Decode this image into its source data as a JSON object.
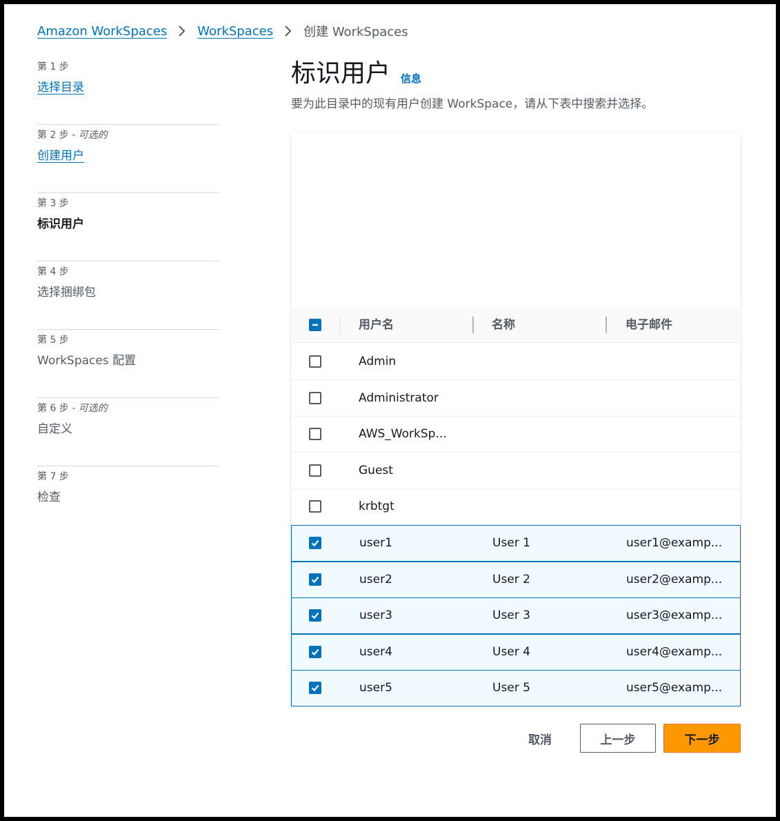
{
  "breadcrumb": {
    "items": [
      "Amazon WorkSpaces",
      "WorkSpaces"
    ],
    "current": "创建 WorkSpaces"
  },
  "steps": [
    {
      "label": "第 1 步",
      "optional": "",
      "title": "选择目录",
      "state": "done"
    },
    {
      "label": "第 2 步",
      "optional": " - 可选的",
      "title": "创建用户",
      "state": "done"
    },
    {
      "label": "第 3 步",
      "optional": "",
      "title": "标识用户",
      "state": "active"
    },
    {
      "label": "第 4 步",
      "optional": "",
      "title": "选择捆绑包",
      "state": "pending"
    },
    {
      "label": "第 5 步",
      "optional": "",
      "title": "WorkSpaces 配置",
      "state": "pending"
    },
    {
      "label": "第 6 步",
      "optional": " - 可选的",
      "title": "自定义",
      "state": "pending"
    },
    {
      "label": "第 7 步",
      "optional": "",
      "title": "检查",
      "state": "pending"
    }
  ],
  "main": {
    "title": "标识用户",
    "info": "信息",
    "description": "要为此目录中的现有用户创建 WorkSpace，请从下表中搜索并选择。"
  },
  "table": {
    "columns": [
      "用户名",
      "名称",
      "电子邮件"
    ],
    "select_all_state": "indeterminate",
    "rows": [
      {
        "username": "Admin",
        "name": "",
        "email": "",
        "selected": false
      },
      {
        "username": "Administrator",
        "name": "",
        "email": "",
        "selected": false
      },
      {
        "username": "AWS_WorkSp...",
        "name": "",
        "email": "",
        "selected": false
      },
      {
        "username": "Guest",
        "name": "",
        "email": "",
        "selected": false
      },
      {
        "username": "krbtgt",
        "name": "",
        "email": "",
        "selected": false
      },
      {
        "username": "user1",
        "name": "User 1",
        "email": "user1@examp...",
        "selected": true
      },
      {
        "username": "user2",
        "name": "User 2",
        "email": "user2@examp...",
        "selected": true
      },
      {
        "username": "user3",
        "name": "User 3",
        "email": "user3@examp...",
        "selected": true
      },
      {
        "username": "user4",
        "name": "User 4",
        "email": "user4@examp...",
        "selected": true
      },
      {
        "username": "user5",
        "name": "User 5",
        "email": "user5@examp...",
        "selected": true
      }
    ]
  },
  "buttons": {
    "cancel": "取消",
    "previous": "上一步",
    "next": "下一步"
  },
  "colors": {
    "link": "#0073bb",
    "primary_button": "#ff9900",
    "selected_row_bg": "#f1faff",
    "selected_row_border": "#0073bb"
  }
}
